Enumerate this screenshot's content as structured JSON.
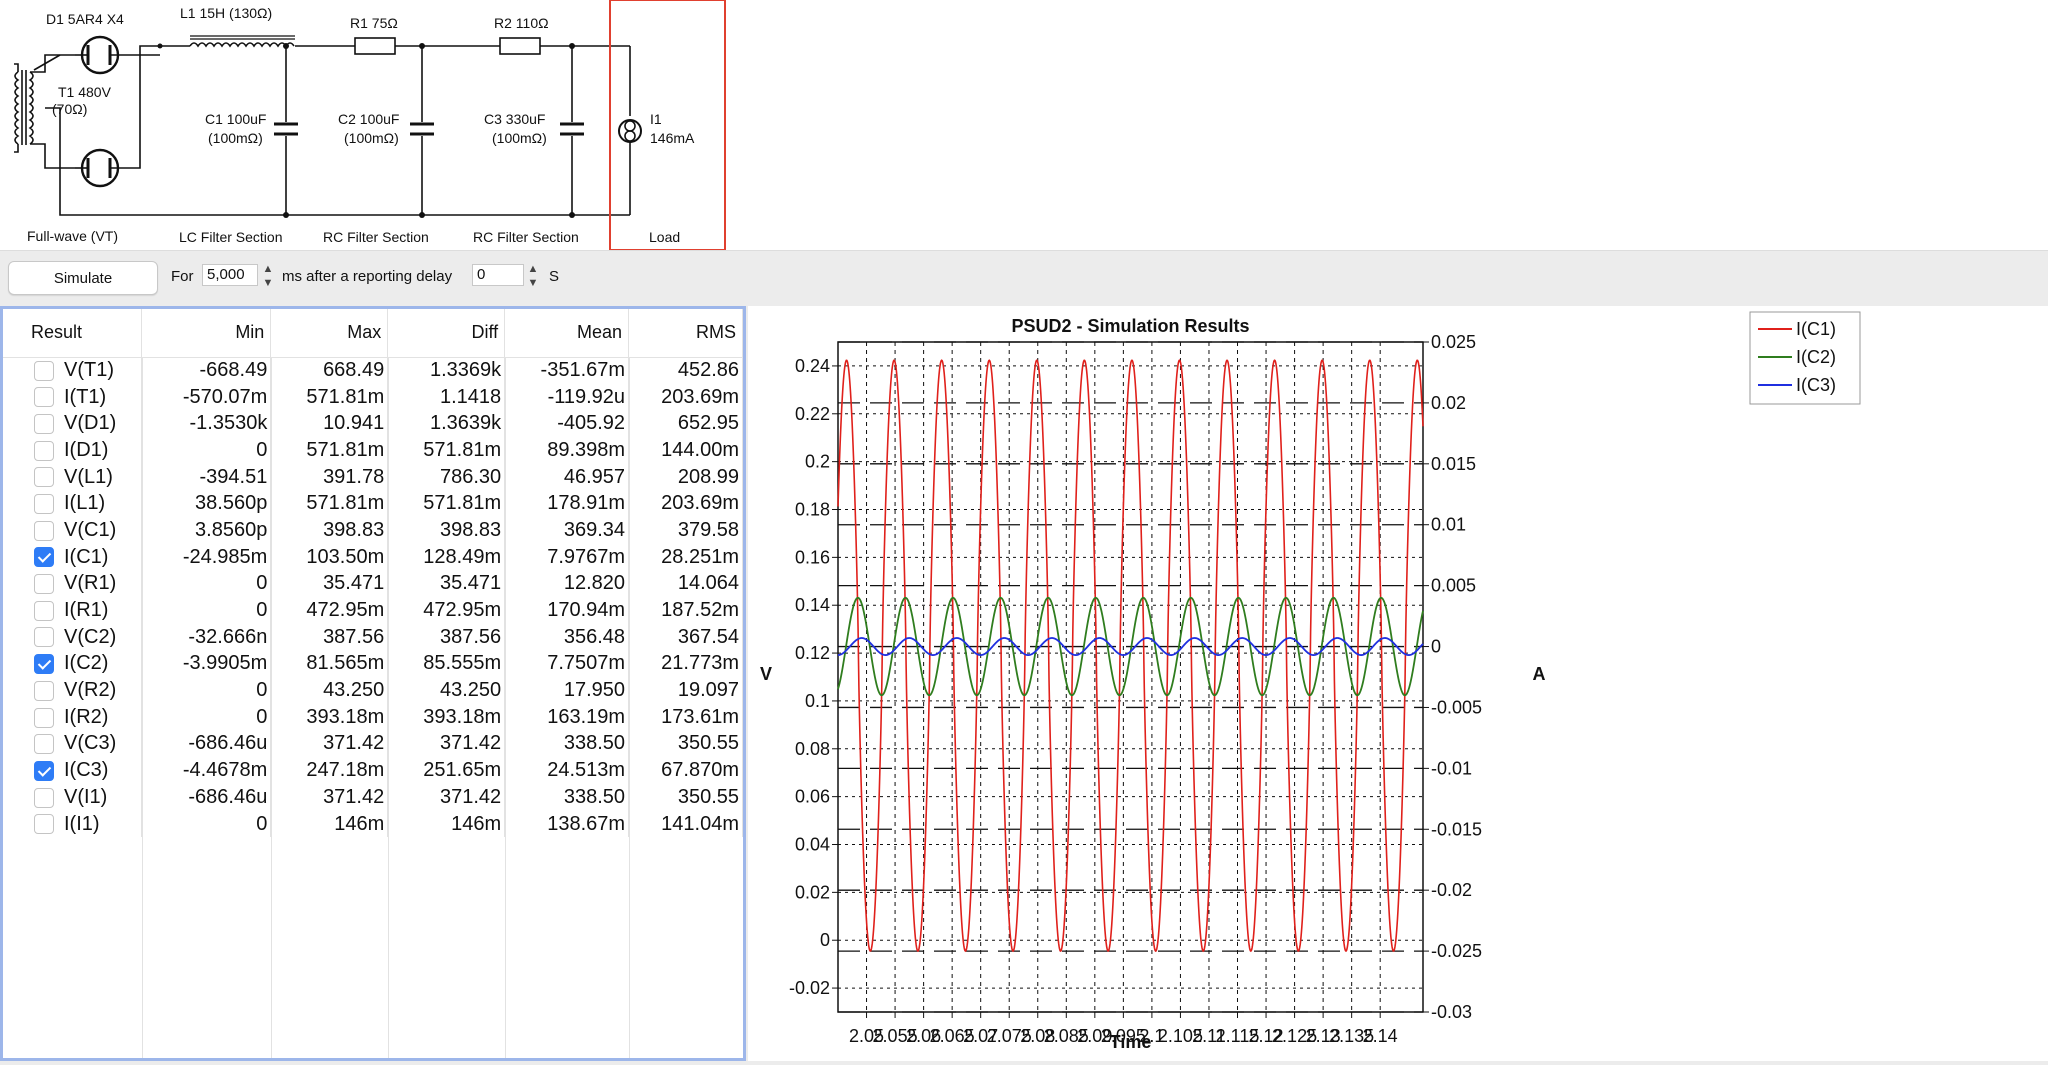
{
  "schematic": {
    "components": [
      {
        "name": "D1",
        "label": "D1 5AR4 X4"
      },
      {
        "name": "L1",
        "label": "L1 15H (130Ω)"
      },
      {
        "name": "R1",
        "label": "R1 75Ω"
      },
      {
        "name": "R2",
        "label": "R2 110Ω"
      },
      {
        "name": "T1",
        "label_line1": "T1 480V",
        "label_line2": "(70Ω)"
      },
      {
        "name": "C1",
        "label_line1": "C1 100uF",
        "label_line2": "(100mΩ)"
      },
      {
        "name": "C2",
        "label_line1": "C2 100uF",
        "label_line2": "(100mΩ)"
      },
      {
        "name": "C3",
        "label_line1": "C3 330uF",
        "label_line2": "(100mΩ)"
      },
      {
        "name": "I1",
        "label_line1": "I1",
        "label_line2": "146mA"
      }
    ],
    "sections": [
      "Full-wave (VT)",
      "LC Filter Section",
      "RC Filter Section",
      "RC Filter Section",
      "Load"
    ],
    "colors": {
      "wire": "#111111",
      "load_highlight": "#e0402f"
    }
  },
  "toolbar": {
    "simulate_label": "Simulate",
    "for_label": "For",
    "duration_value": "5,000",
    "ms_label": "ms after a reporting delay",
    "delay_value": "0",
    "s_label": "S",
    "stepper_icon": "up-down-chevron"
  },
  "results": {
    "headers": [
      "Result",
      "Min",
      "Max",
      "Diff",
      "Mean",
      "RMS"
    ],
    "rows": [
      {
        "checked": false,
        "name": "V(T1)",
        "min": "-668.49",
        "max": "668.49",
        "diff": "1.3369k",
        "mean": "-351.67m",
        "rms": "452.86"
      },
      {
        "checked": false,
        "name": "I(T1)",
        "min": "-570.07m",
        "max": "571.81m",
        "diff": "1.1418",
        "mean": "-119.92u",
        "rms": "203.69m"
      },
      {
        "checked": false,
        "name": "V(D1)",
        "min": "-1.3530k",
        "max": "10.941",
        "diff": "1.3639k",
        "mean": "-405.92",
        "rms": "652.95"
      },
      {
        "checked": false,
        "name": "I(D1)",
        "min": "0",
        "max": "571.81m",
        "diff": "571.81m",
        "mean": "89.398m",
        "rms": "144.00m"
      },
      {
        "checked": false,
        "name": "V(L1)",
        "min": "-394.51",
        "max": "391.78",
        "diff": "786.30",
        "mean": "46.957",
        "rms": "208.99"
      },
      {
        "checked": false,
        "name": "I(L1)",
        "min": "38.560p",
        "max": "571.81m",
        "diff": "571.81m",
        "mean": "178.91m",
        "rms": "203.69m"
      },
      {
        "checked": false,
        "name": "V(C1)",
        "min": "3.8560p",
        "max": "398.83",
        "diff": "398.83",
        "mean": "369.34",
        "rms": "379.58"
      },
      {
        "checked": true,
        "name": "I(C1)",
        "min": "-24.985m",
        "max": "103.50m",
        "diff": "128.49m",
        "mean": "7.9767m",
        "rms": "28.251m"
      },
      {
        "checked": false,
        "name": "V(R1)",
        "min": "0",
        "max": "35.471",
        "diff": "35.471",
        "mean": "12.820",
        "rms": "14.064"
      },
      {
        "checked": false,
        "name": "I(R1)",
        "min": "0",
        "max": "472.95m",
        "diff": "472.95m",
        "mean": "170.94m",
        "rms": "187.52m"
      },
      {
        "checked": false,
        "name": "V(C2)",
        "min": "-32.666n",
        "max": "387.56",
        "diff": "387.56",
        "mean": "356.48",
        "rms": "367.54"
      },
      {
        "checked": true,
        "name": "I(C2)",
        "min": "-3.9905m",
        "max": "81.565m",
        "diff": "85.555m",
        "mean": "7.7507m",
        "rms": "21.773m"
      },
      {
        "checked": false,
        "name": "V(R2)",
        "min": "0",
        "max": "43.250",
        "diff": "43.250",
        "mean": "17.950",
        "rms": "19.097"
      },
      {
        "checked": false,
        "name": "I(R2)",
        "min": "0",
        "max": "393.18m",
        "diff": "393.18m",
        "mean": "163.19m",
        "rms": "173.61m"
      },
      {
        "checked": false,
        "name": "V(C3)",
        "min": "-686.46u",
        "max": "371.42",
        "diff": "371.42",
        "mean": "338.50",
        "rms": "350.55"
      },
      {
        "checked": true,
        "name": "I(C3)",
        "min": "-4.4678m",
        "max": "247.18m",
        "diff": "251.65m",
        "mean": "24.513m",
        "rms": "67.870m"
      },
      {
        "checked": false,
        "name": "V(I1)",
        "min": "-686.46u",
        "max": "371.42",
        "diff": "371.42",
        "mean": "338.50",
        "rms": "350.55"
      },
      {
        "checked": false,
        "name": "I(I1)",
        "min": "0",
        "max": "146m",
        "diff": "146m",
        "mean": "138.67m",
        "rms": "141.04m"
      }
    ]
  },
  "chart_data": {
    "type": "line",
    "title": "PSUD2 - Simulation Results",
    "xlabel": "Time",
    "ylabel_left": "V",
    "ylabel_right": "A",
    "xlim": [
      2.045,
      2.1475
    ],
    "ylim_left": [
      -0.03,
      0.25
    ],
    "ylim_right": [
      -0.03,
      0.025
    ],
    "x_ticks": [
      2.05,
      2.055,
      2.06,
      2.065,
      2.07,
      2.075,
      2.08,
      2.085,
      2.09,
      2.095,
      2.1,
      2.105,
      2.11,
      2.115,
      2.12,
      2.125,
      2.13,
      2.135,
      2.14
    ],
    "x_tick_labels": [
      "2.05",
      "2.055",
      "2.06",
      "2.065",
      "2.07",
      "2.075",
      "2.08",
      "2.085",
      "2.09",
      "2.095",
      "2.1",
      "2.105",
      "2.11",
      "2.115",
      "2.12",
      "2.125",
      "2.13",
      "2.135",
      "2.14"
    ],
    "y_left_ticks": [
      -0.02,
      0,
      0.02,
      0.04,
      0.06,
      0.08,
      0.1,
      0.12,
      0.14,
      0.16,
      0.18,
      0.2,
      0.22,
      0.24
    ],
    "y_left_tick_labels": [
      "-0.02",
      "0",
      "0.02",
      "0.04",
      "0.06",
      "0.08",
      "0.1",
      "0.12",
      "0.14",
      "0.16",
      "0.18",
      "0.2",
      "0.22",
      "0.24"
    ],
    "y_right_ticks": [
      -0.03,
      -0.025,
      -0.02,
      -0.015,
      -0.01,
      -0.005,
      0,
      0.005,
      0.01,
      0.015,
      0.02,
      0.025
    ],
    "y_right_tick_labels": [
      "-0.03",
      "-0.025",
      "-0.02",
      "-0.015",
      "-0.01",
      "-0.005",
      "0",
      "0.005",
      "0.01",
      "0.015",
      "0.02",
      "0.025"
    ],
    "grid": true,
    "legend_placement": "top-right",
    "series": [
      {
        "name": "I(C1)",
        "color": "#e0201b",
        "axis": "right",
        "ripple_hz": 120,
        "min": -0.025,
        "max": 0.0235
      },
      {
        "name": "I(C2)",
        "color": "#2f7d1e",
        "axis": "right",
        "ripple_hz": 120,
        "min": -0.004,
        "max": 0.004
      },
      {
        "name": "I(C3)",
        "color": "#1f2fe0",
        "axis": "right",
        "ripple_hz": 120,
        "min": -0.0007,
        "max": 0.0007
      }
    ]
  }
}
